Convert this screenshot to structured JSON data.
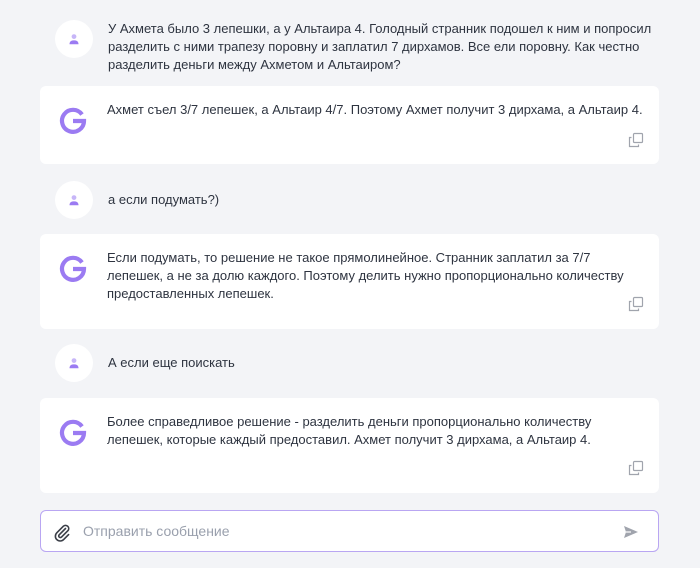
{
  "colors": {
    "background": "#f3f4f7",
    "bubble": "#ffffff",
    "accent": "#9b7bf2",
    "icon_muted": "#a0a4ad",
    "input_border": "#b9a6f2"
  },
  "messages": [
    {
      "role": "user",
      "text": "У Ахмета было 3 лепешки, а у Альтаира 4. Голодный странник подошел к ним и попросил разделить с ними трапезу поровну и заплатил 7 дирхамов. Все ели поровну. Как честно разделить деньги между Ахметом и Альтаиром?",
      "avatar_icon": "user-icon"
    },
    {
      "role": "assistant",
      "text": "Ахмет съел 3/7 лепешек, а Альтаир 4/7. Поэтому Ахмет получит 3 дирхама, а Альтаир 4.",
      "logo_icon": "g-logo-icon",
      "action_icon": "copy-icon"
    },
    {
      "role": "user",
      "text": "а если подумать?)",
      "avatar_icon": "user-icon"
    },
    {
      "role": "assistant",
      "text": "Если подумать, то решение не такое прямолинейное. Странник заплатил за 7/7 лепешек, а не за долю каждого. Поэтому делить нужно пропорционально количеству предоставленных лепешек.",
      "logo_icon": "g-logo-icon",
      "action_icon": "copy-icon"
    },
    {
      "role": "user",
      "text": "А если еще поискать",
      "avatar_icon": "user-icon"
    },
    {
      "role": "assistant",
      "text": "Более справедливое решение - разделить деньги пропорционально количеству лепешек, которые каждый предоставил. Ахмет получит 3 дирхама, а Альтаир 4.",
      "logo_icon": "g-logo-icon",
      "action_icon": "copy-icon"
    }
  ],
  "composer": {
    "placeholder": "Отправить сообщение",
    "value": "",
    "attach_icon": "paperclip-icon",
    "send_icon": "send-icon"
  }
}
